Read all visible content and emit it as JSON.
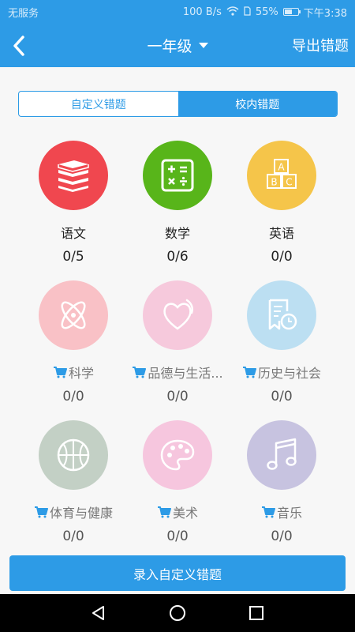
{
  "status_bar": {
    "carrier": "无服务",
    "speed": "100 B/s",
    "battery_percent": "55%",
    "battery_level": 0.55,
    "time": "下午3:38"
  },
  "app_bar": {
    "title": "一年级",
    "export_label": "导出错题"
  },
  "tabs": [
    {
      "label": "自定义错题",
      "active": false
    },
    {
      "label": "校内错题",
      "active": true
    }
  ],
  "subjects": [
    {
      "name": "语文",
      "count": "0/5",
      "color": "#f0474f",
      "icon": "books-icon",
      "locked": false
    },
    {
      "name": "数学",
      "count": "0/6",
      "color": "#58b51a",
      "icon": "calculator-icon",
      "locked": false
    },
    {
      "name": "英语",
      "count": "0/0",
      "color": "#f5c54a",
      "icon": "abc-blocks-icon",
      "locked": false
    },
    {
      "name": "科学",
      "count": "0/0",
      "color": "#f9c1c6",
      "icon": "atom-icon",
      "locked": true
    },
    {
      "name": "品德与生活...",
      "count": "0/0",
      "color": "#f6c9dc",
      "icon": "heart-icon",
      "locked": true
    },
    {
      "name": "历史与社会",
      "count": "0/0",
      "color": "#bcdff2",
      "icon": "history-icon",
      "locked": true
    },
    {
      "name": "体育与健康",
      "count": "0/0",
      "color": "#c3d0c5",
      "icon": "basketball-icon",
      "locked": true
    },
    {
      "name": "美术",
      "count": "0/0",
      "color": "#f6c6de",
      "icon": "palette-icon",
      "locked": true
    },
    {
      "name": "音乐",
      "count": "0/0",
      "color": "#c7c3e0",
      "icon": "music-note-icon",
      "locked": true
    }
  ],
  "record_button_label": "录入自定义错题",
  "colors": {
    "primary": "#2d9be6",
    "cart": "#2d9be6"
  }
}
